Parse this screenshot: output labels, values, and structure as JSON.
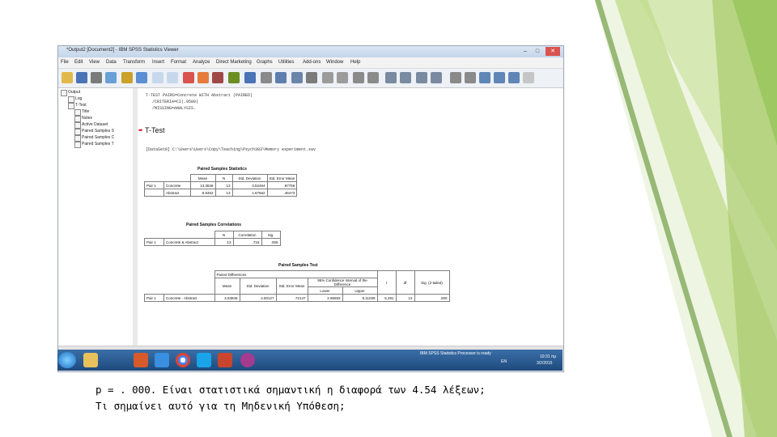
{
  "window": {
    "title": "*Output2 [Document2] - IBM SPSS Statistics Viewer",
    "controls": [
      "minimize-icon",
      "maximize-icon",
      "close-icon"
    ]
  },
  "menu": [
    "File",
    "Edit",
    "View",
    "Data",
    "Transform",
    "Insert",
    "Format",
    "Analyze",
    "Direct Marketing",
    "Graphs",
    "Utilities",
    "Add-ons",
    "Window",
    "Help"
  ],
  "outline": {
    "root": "Output",
    "items": [
      "Log",
      "T-Test",
      "Title",
      "Notes",
      "Active Dataset",
      "Paired Samples S",
      "Paired Samples C",
      "Paired Samples T"
    ]
  },
  "syntax": {
    "line1": "T-TEST PAIRS=Concrete WITH Abstract (PAIRED)",
    "line2": "/CRITERIA=CI(.9500)",
    "line3": "/MISSING=ANALYSIS."
  },
  "section_title": "T-Test",
  "dataset_line": "[DataSet0] C:\\Users\\Users\\Copy\\Teaching\\Psych303\\Memory experiment.sav",
  "stats_table": {
    "title": "Paired Samples Statistics",
    "headers": [
      "Mean",
      "N",
      "Std. Deviation",
      "Std. Error Mean"
    ],
    "pair_label": "Pair 1",
    "rows": [
      {
        "label": "Concrete",
        "mean": "13.3846",
        "n": "13",
        "sd": "3.52464",
        "se": ".97756"
      },
      {
        "label": "Abstract",
        "mean": "8.8462",
        "n": "13",
        "sd": "1.67562",
        "se": ".46473"
      }
    ]
  },
  "corr_table": {
    "title": "Paired Samples Correlations",
    "headers": [
      "N",
      "Correlation",
      "Sig."
    ],
    "row": {
      "pair": "Pair 1",
      "label": "Concrete & Abstract",
      "n": "13",
      "corr": ".716",
      "sig": ".006"
    }
  },
  "ttest_table": {
    "title": "Paired Samples Test",
    "group_header": "Paired Differences",
    "ci_header": "95% Confidence Interval of the Difference",
    "headers": [
      "Mean",
      "Std. Deviation",
      "Std. Error Mean",
      "Lower",
      "Upper",
      "t",
      "df",
      "Sig. (2-tailed)"
    ],
    "row": {
      "pair": "Pair 1",
      "label": "Concrete - Abstract",
      "mean": "4.53846",
      "sd": "2.60127",
      "se": ".72147",
      "lower": "2.96653",
      "upper": "6.11039",
      "t": "6.291",
      "df": "12",
      "sig": ".000"
    }
  },
  "taskbar": {
    "apps": [
      "explorer-icon",
      "matlab-icon",
      "dropbox-icon",
      "chrome-icon",
      "skype-icon",
      "powerpoint-icon",
      "spss-icon"
    ],
    "status_text": "IBM SPSS Statistics Processor is ready",
    "language": "EN",
    "time": "10:31 πμ",
    "date": "3/2/2015"
  },
  "caption": {
    "line1": "p = . 000. Είναι στατιστικά σημαντική η διαφορά των 4.54 λέξεων;",
    "line2": "Τι σημαίνει αυτό για τη Μηδενική Υπόθεση;"
  },
  "colors": {
    "green_light": "#d6e8b4",
    "green_mid": "#a9cc6e",
    "green_dark": "#5f8f2e",
    "taskbar_blue": "#1d4a7d",
    "arrow_red": "#d0121b"
  }
}
